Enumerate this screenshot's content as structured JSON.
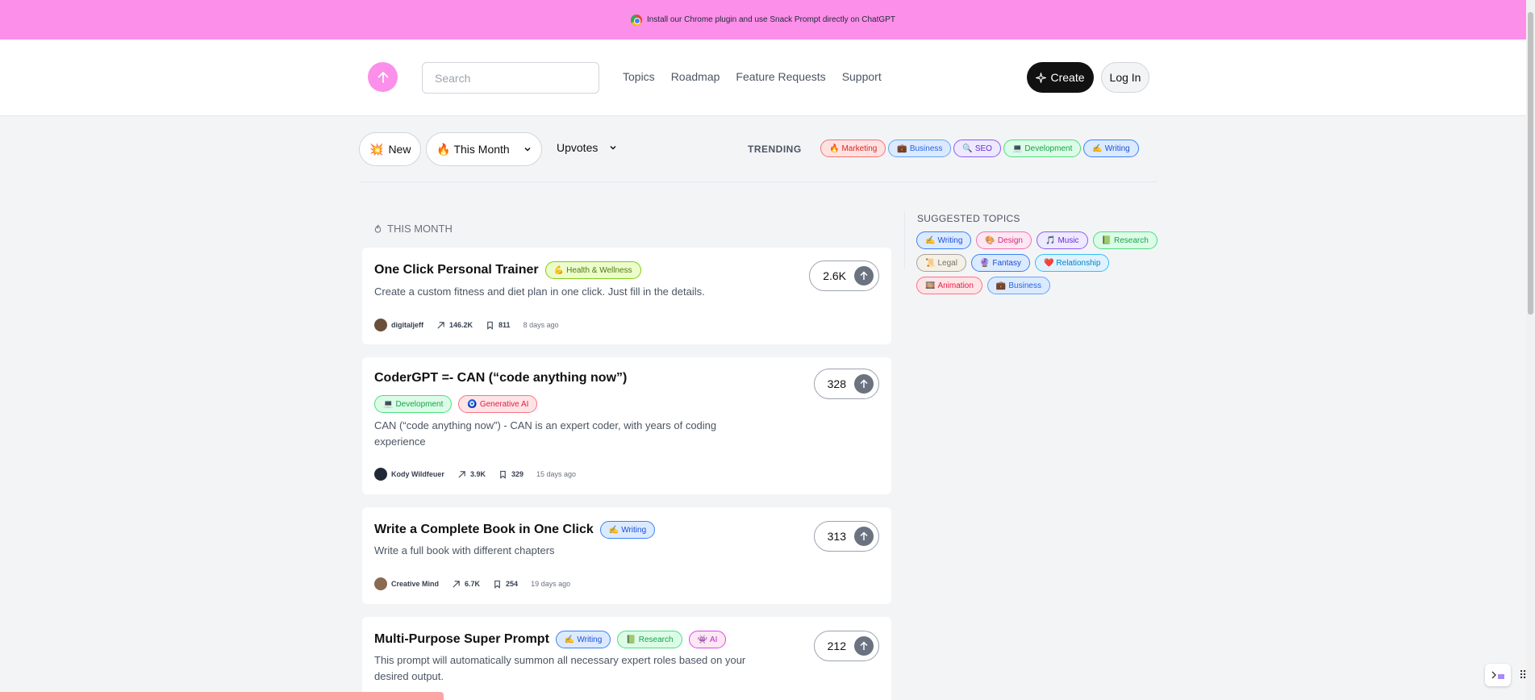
{
  "banner": {
    "text": "Install our Chrome plugin and use Snack Prompt directly on ChatGPT"
  },
  "nav": {
    "search_placeholder": "Search",
    "links": [
      "Topics",
      "Roadmap",
      "Feature Requests",
      "Support"
    ],
    "create_label": "Create",
    "login_label": "Log In"
  },
  "filters": {
    "new_label": "New",
    "period_label": "This Month",
    "sort_label": "Upvotes",
    "trending_label": "TRENDING",
    "trending_tags": [
      {
        "icon": "🔥",
        "label": "Marketing",
        "color": "red"
      },
      {
        "icon": "💼",
        "label": "Business",
        "color": "blue"
      },
      {
        "icon": "🔍",
        "label": "SEO",
        "color": "purple"
      },
      {
        "icon": "💻",
        "label": "Development",
        "color": "green"
      },
      {
        "icon": "✍️",
        "label": "Writing",
        "color": "indigo"
      }
    ]
  },
  "section_label": "THIS MONTH",
  "prompts": [
    {
      "title": "One Click Personal Trainer",
      "tags": [
        {
          "icon": "💪",
          "label": "Health & Wellness",
          "color": "lime"
        }
      ],
      "description": "Create a custom fitness and diet plan in one click. Just fill in the details.",
      "author": "digitaljeff",
      "views": "146.2K",
      "saves": "811",
      "ago": "8 days ago",
      "votes": "2.6K"
    },
    {
      "title": "CoderGPT =- CAN (“code anything now”)",
      "tags": [
        {
          "icon": "💻",
          "label": "Development",
          "color": "green"
        },
        {
          "icon": "🧿",
          "label": "Generative AI",
          "color": "rose"
        }
      ],
      "description": "CAN (“code anything now”) - CAN is an expert coder, with years of coding experience",
      "author": "Kody Wildfeuer",
      "views": "3.9K",
      "saves": "329",
      "ago": "15 days ago",
      "votes": "328"
    },
    {
      "title": "Write a Complete Book in One Click",
      "tags": [
        {
          "icon": "✍️",
          "label": "Writing",
          "color": "indigo"
        }
      ],
      "description": "Write a full book with different chapters",
      "author": "Creative Mind",
      "views": "6.7K",
      "saves": "254",
      "ago": "19 days ago",
      "votes": "313"
    },
    {
      "title": "Multi-Purpose Super Prompt",
      "tags": [
        {
          "icon": "✍️",
          "label": "Writing",
          "color": "indigo"
        },
        {
          "icon": "📗",
          "label": "Research",
          "color": "green"
        },
        {
          "icon": "👾",
          "label": "AI",
          "color": "magenta"
        }
      ],
      "description": "This prompt will automatically summon all necessary expert roles based on your desired output.",
      "votes": "212"
    }
  ],
  "suggested": {
    "label": "SUGGESTED TOPICS",
    "tags": [
      {
        "icon": "✍️",
        "label": "Writing",
        "color": "indigo"
      },
      {
        "icon": "🎨",
        "label": "Design",
        "color": "pink"
      },
      {
        "icon": "🎵",
        "label": "Music",
        "color": "purple"
      },
      {
        "icon": "📗",
        "label": "Research",
        "color": "green"
      },
      {
        "icon": "📜",
        "label": "Legal",
        "color": "brown"
      },
      {
        "icon": "🔮",
        "label": "Fantasy",
        "color": "indigo"
      },
      {
        "icon": "❤️",
        "label": "Relationship",
        "color": "sky"
      },
      {
        "icon": "🎞️",
        "label": "Animation",
        "color": "rose"
      },
      {
        "icon": "💼",
        "label": "Business",
        "color": "blue"
      }
    ]
  }
}
